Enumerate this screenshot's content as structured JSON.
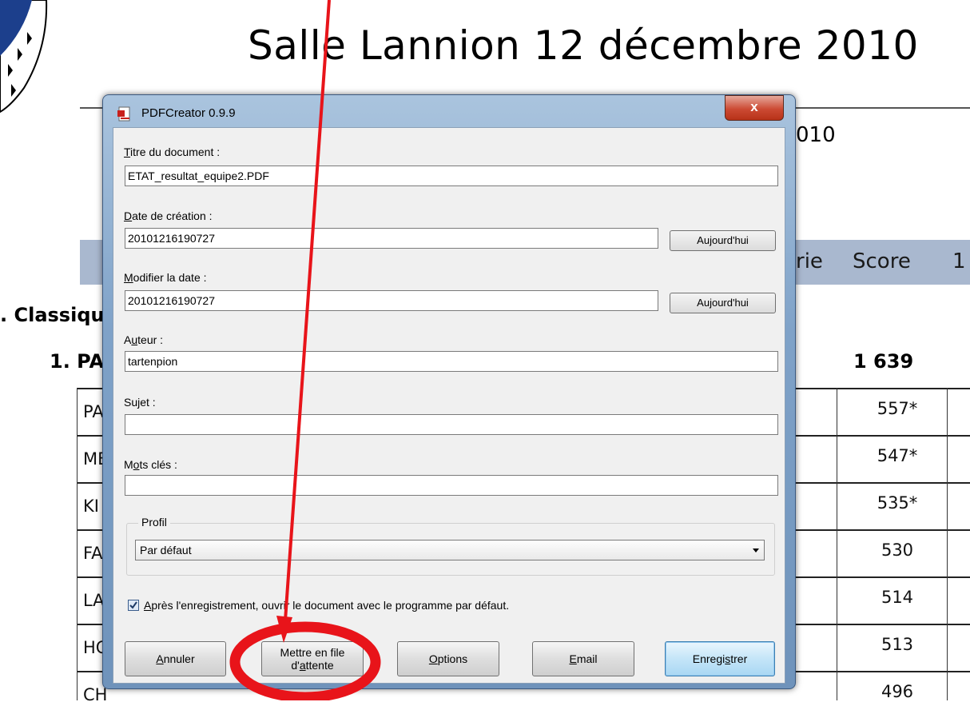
{
  "document": {
    "title": "Salle Lannion 12 décembre 2010",
    "date_fragment": "010",
    "table_headers": {
      "rie": "rie",
      "score": "Score",
      "extra": "1"
    },
    "section": "Classiqu",
    "team_label": "1. PA",
    "team_score": "1 639",
    "rows": [
      {
        "name": "PA",
        "score": "557*"
      },
      {
        "name": "ME",
        "score": "547*"
      },
      {
        "name": "KI",
        "score": "535*"
      },
      {
        "name": "FA",
        "score": "530"
      },
      {
        "name": "LA",
        "score": "514"
      },
      {
        "name": "HC",
        "score": "513"
      },
      {
        "name": "CH",
        "score": "496"
      }
    ]
  },
  "dialog": {
    "title": "PDFCreator 0.9.9",
    "close_label": "x",
    "fields": {
      "doc_title": {
        "label_key": "T",
        "label_rest": "itre du document :",
        "value": "ETAT_resultat_equipe2.PDF"
      },
      "creation_date": {
        "label_key": "D",
        "label_rest": "ate de création :",
        "value": "20101216190727",
        "button": "Aujourd'hui"
      },
      "modify_date": {
        "label_key": "M",
        "label_rest": "odifier la date :",
        "value": "20101216190727",
        "button": "Aujourd'hui"
      },
      "author": {
        "label_pre": "A",
        "label_key": "u",
        "label_rest": "teur :",
        "value": "tartenpion"
      },
      "subject": {
        "label": "Sujet :",
        "value": ""
      },
      "keywords": {
        "label_pre": "M",
        "label_key": "o",
        "label_rest": "ts clés :",
        "value": ""
      }
    },
    "profile": {
      "group_label": "Profil",
      "selected": "Par défaut"
    },
    "open_after": {
      "checked": true,
      "key": "A",
      "label_rest": "près l'enregistrement, ouvrir le document avec le programme par défaut."
    },
    "buttons": {
      "cancel": {
        "key": "A",
        "rest": "nnuler"
      },
      "queue": {
        "line1": "Mettre en file",
        "line2_pre": "d'",
        "line2_key": "a",
        "line2_rest": "ttente"
      },
      "options": {
        "key": "O",
        "rest": "ptions"
      },
      "email": {
        "key": "E",
        "rest": "mail"
      },
      "save": {
        "pre": "Enregi",
        "key": "s",
        "rest": "trer"
      }
    }
  },
  "annotation_color": "#e8141a"
}
